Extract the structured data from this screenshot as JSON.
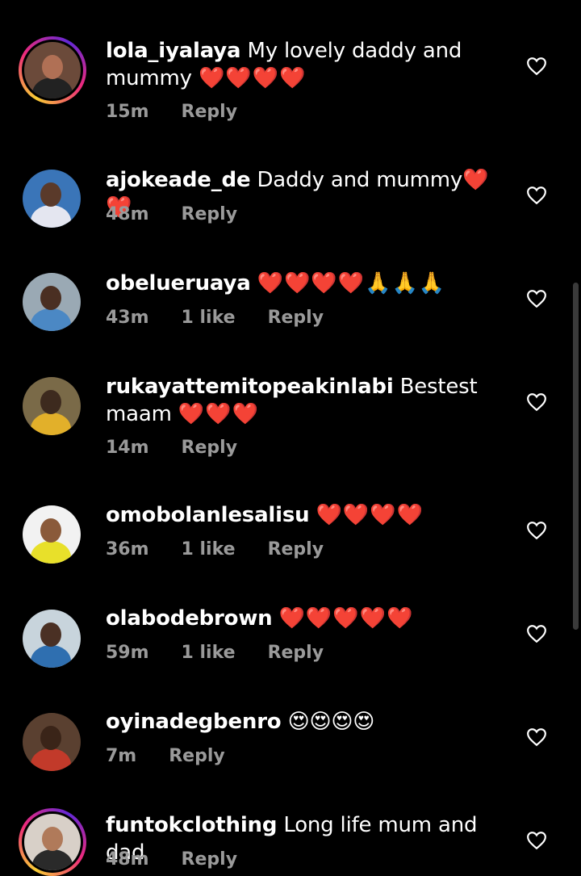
{
  "comments": [
    {
      "username": "lola_iyalaya",
      "text": "My lovely daddy and mummy",
      "emojis": "❤️❤️❤️❤️",
      "time": "15m",
      "likes": "",
      "reply": "Reply",
      "story_ring": true
    },
    {
      "username": "ajokeade_de",
      "text": "Daddy and mummy",
      "emojis": "❤️❤️",
      "time": "48m",
      "likes": "",
      "reply": "Reply",
      "story_ring": false
    },
    {
      "username": "obelueruaya",
      "text": "",
      "emojis": "❤️❤️❤️❤️🙏🙏🙏",
      "time": "43m",
      "likes": "1 like",
      "reply": "Reply",
      "story_ring": false
    },
    {
      "username": "rukayattemitopeakinlabi",
      "text": "Bestest maam",
      "emojis": "❤️❤️❤️",
      "time": "14m",
      "likes": "",
      "reply": "Reply",
      "story_ring": false
    },
    {
      "username": "omobolanlesalisu",
      "text": "",
      "emojis": "❤️❤️❤️❤️",
      "time": "36m",
      "likes": "1 like",
      "reply": "Reply",
      "story_ring": false
    },
    {
      "username": "olabodebrown",
      "text": "",
      "emojis": "❤️❤️❤️❤️❤️",
      "time": "59m",
      "likes": "1 like",
      "reply": "Reply",
      "story_ring": false
    },
    {
      "username": "oyinadegbenro",
      "text": "",
      "emojis": "😍😍😍😍",
      "time": "7m",
      "likes": "",
      "reply": "Reply",
      "story_ring": false
    },
    {
      "username": "funtokclothing",
      "text": "Long life mum and dad",
      "emojis": "",
      "time": "48m",
      "likes": "",
      "reply": "Reply",
      "story_ring": true
    }
  ],
  "colors": {
    "background": "#000000",
    "meta_text": "#9a9a9a",
    "heart": "#ff2d3a"
  }
}
